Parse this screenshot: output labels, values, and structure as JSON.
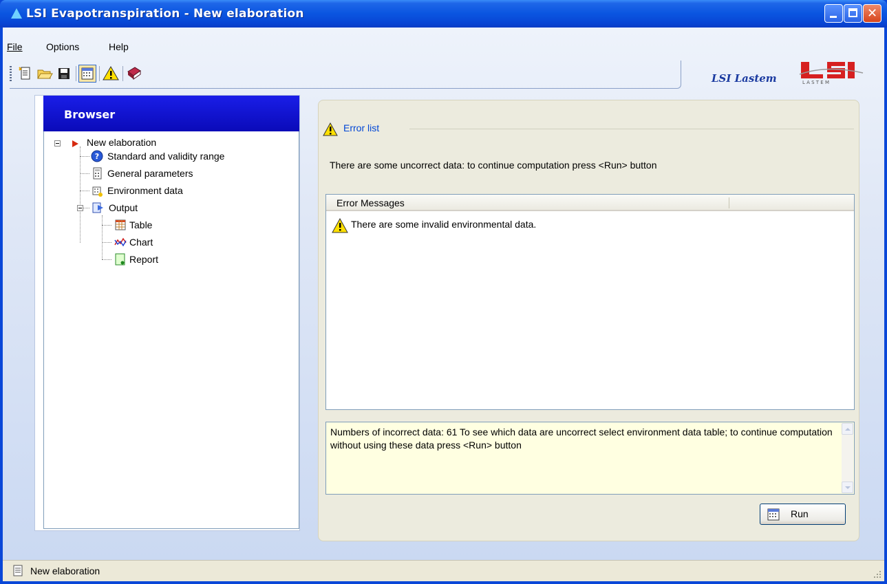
{
  "window": {
    "title": "LSI Evapotranspiration - New elaboration"
  },
  "menu": {
    "items": [
      {
        "label": "File",
        "accel": "F"
      },
      {
        "label": "Options",
        "accel": "O"
      },
      {
        "label": "Help",
        "accel": "H"
      }
    ]
  },
  "toolbar": {
    "buttons": [
      "new-document-icon",
      "open-folder-icon",
      "save-icon",
      "run-calculation-icon",
      "warning-icon",
      "help-book-icon"
    ]
  },
  "branding": {
    "text": "LSI Lastem"
  },
  "browser": {
    "title": "Browser",
    "tree": {
      "root": "New elaboration",
      "children": [
        "Standard and validity range",
        "General parameters",
        "Environment data",
        "Output"
      ],
      "output_children": [
        "Table",
        "Chart",
        "Report"
      ]
    }
  },
  "error_panel": {
    "title": "Error list",
    "message": "There are some uncorrect data: to continue computation press <Run> button",
    "list_header": "Error Messages",
    "list_items": [
      "There are some invalid environmental data."
    ],
    "details": "Numbers of incorrect data: 61 To see which data are uncorrect select environment data table; to continue computation without using these data press <Run> button",
    "run_label": "Run"
  },
  "status": {
    "text": "New elaboration"
  },
  "colors": {
    "title_bar": "#0a55e0",
    "browser_header": "#1a1ee8",
    "memo_bg": "#ffffe1",
    "panel_bg": "#ecebde"
  }
}
